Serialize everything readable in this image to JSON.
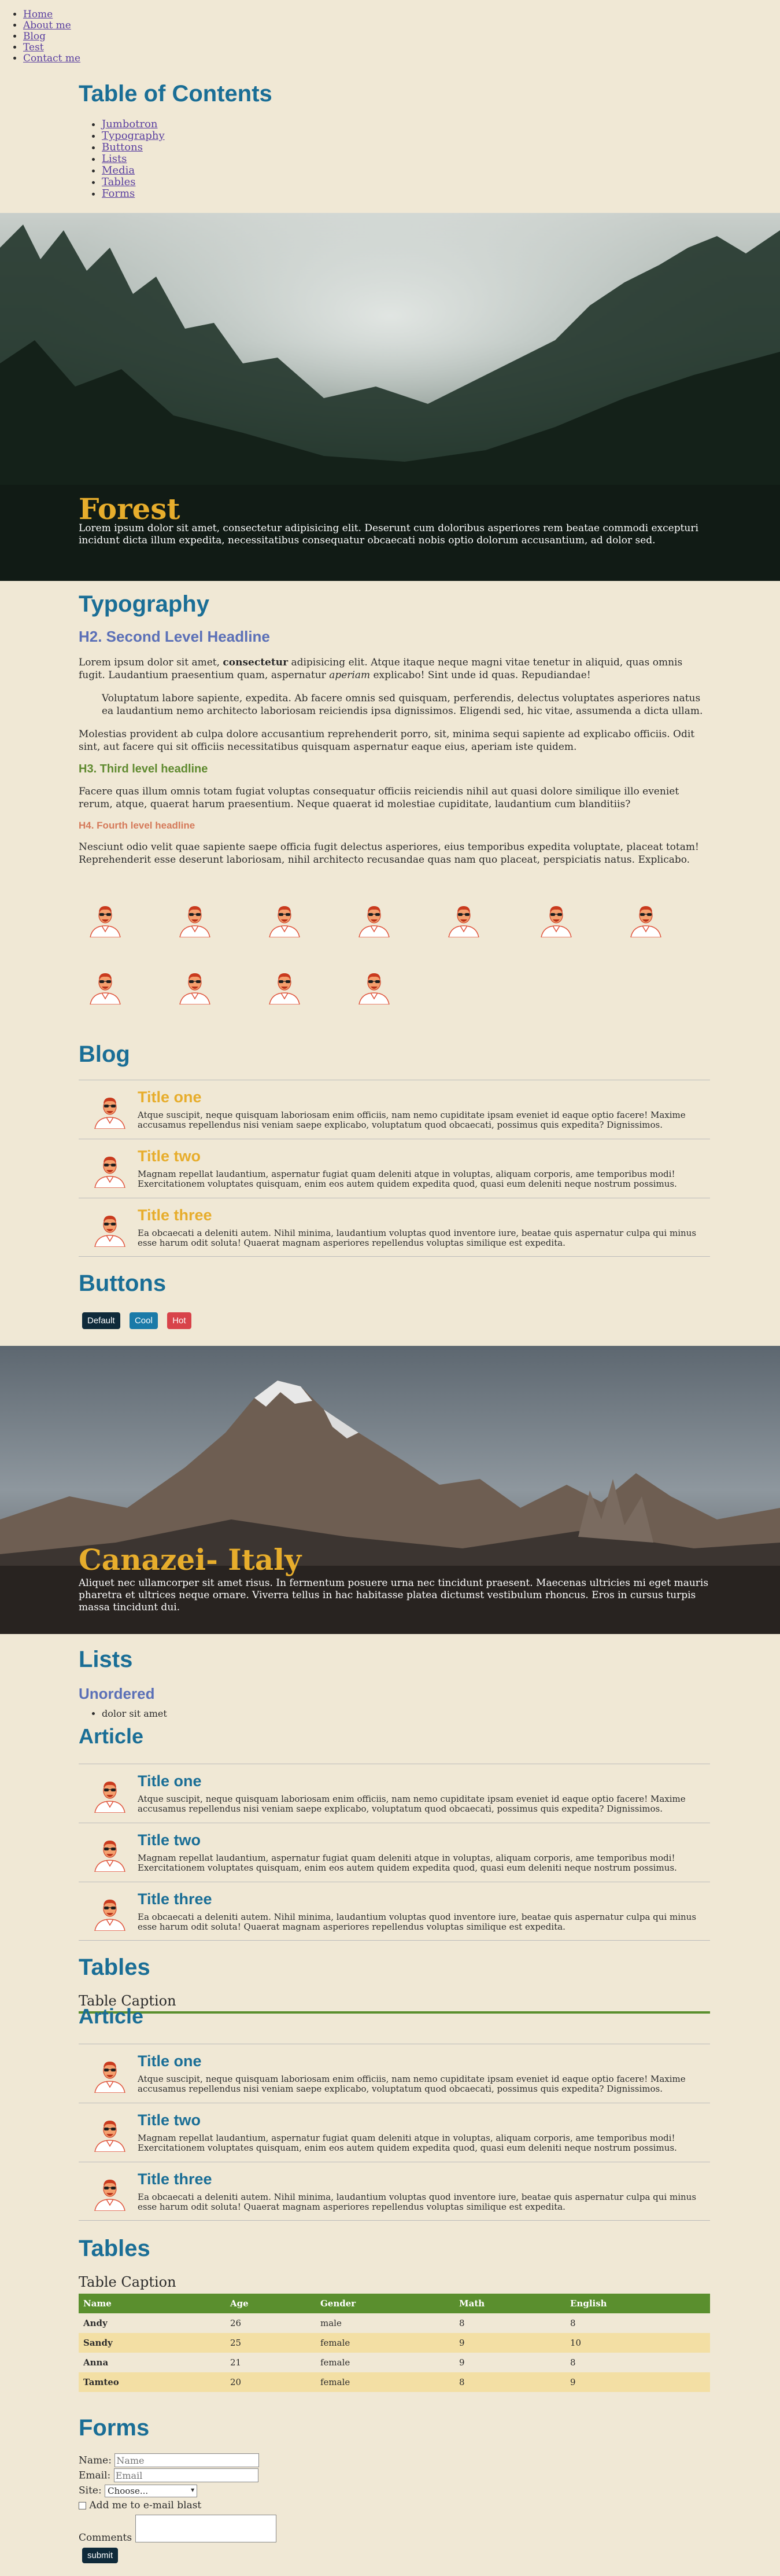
{
  "nav": [
    "Home",
    "About me",
    "Blog",
    "Test",
    "Contact me"
  ],
  "toc": {
    "title": "Table of Contents",
    "items": [
      "Jumbotron",
      "Typography",
      "Buttons",
      "Lists",
      "Media",
      "Tables",
      "Forms"
    ]
  },
  "hero1": {
    "title": "Forest",
    "text": "Lorem ipsum dolor sit amet, consectetur adipisicing elit. Deserunt cum doloribus asperiores rem beatae commodi excepturi incidunt dicta illum expedita, necessitatibus consequatur obcaecati nobis optio dolorum accusantium, ad dolor sed."
  },
  "typography": {
    "title": "Typography",
    "h2": "H2. Second Level Headline",
    "p1_a": "Lorem ipsum dolor sit amet, ",
    "p1_b": "consectetur",
    "p1_c": " adipisicing elit. Atque itaque neque magni vitae tenetur in aliquid, quas omnis fugit. Laudantium praesentium quam, aspernatur ",
    "p1_d": "aperiam",
    "p1_e": " explicabo! Sint unde id quas. Repudiandae!",
    "quote": "Voluptatum labore sapiente, expedita. Ab facere omnis sed quisquam, perferendis, delectus voluptates asperiores natus ea laudantium nemo architecto laboriosam reiciendis ipsa dignissimos. Eligendi sed, hic vitae, assumenda a dicta ullam.",
    "p2": "Molestias provident ab culpa dolore accusantium reprehenderit porro, sit, minima sequi sapiente ad explicabo officiis. Odit sint, aut facere qui sit officiis necessitatibus quisquam aspernatur eaque eius, aperiam iste quidem.",
    "h3": "H3. Third level headline",
    "p3": "Facere quas illum omnis totam fugiat voluptas consequatur officiis reiciendis nihil aut quasi dolore similique illo eveniet rerum, atque, quaerat harum praesentium. Neque quaerat id molestiae cupiditate, laudantium cum blanditiis?",
    "h4": "H4. Fourth level headline",
    "p4": "Nesciunt odio velit quae sapiente saepe officia fugit delectus asperiores, eius temporibus expedita voluptate, placeat totam! Reprehenderit esse deserunt laboriosam, nihil architecto recusandae quas nam quo placeat, perspiciatis natus. Explicabo."
  },
  "articles": [
    {
      "title": "Title one",
      "desc": "Atque suscipit, neque quisquam laboriosam enim officiis, nam nemo cupiditate ipsam eveniet id eaque optio facere! Maxime accusamus repellendus nisi veniam saepe explicabo, voluptatum quod obcaecati, possimus quis expedita? Dignissimos."
    },
    {
      "title": "Title two",
      "desc": "Magnam repellat laudantium, aspernatur fugiat quam deleniti atque in voluptas, aliquam corporis, ame temporibus modi! Exercitationem voluptates quisquam, enim eos autem quidem expedita quod, quasi eum deleniti neque nostrum possimus."
    },
    {
      "title": "Title three",
      "desc": "Ea obcaecati a deleniti autem. Nihil minima, laudantium voluptas quod inventore iure, beatae quis aspernatur culpa qui minus esse harum odit soluta! Quaerat magnam asperiores repellendus voluptas similique est expedita."
    }
  ],
  "blog": {
    "title": "Blog"
  },
  "buttons": {
    "title": "Buttons",
    "default": "Default",
    "cool": "Cool",
    "hot": "Hot"
  },
  "hero2": {
    "title": "Canazei- Italy",
    "text": "Aliquet nec ullamcorper sit amet risus. In fermentum posuere urna nec tincidunt praesent. Maecenas ultricies mi eget mauris pharetra et ultrices neque ornare. Viverra tellus in hac habitasse platea dictumst vestibulum rhoncus. Eros in cursus turpis massa tincidunt dui."
  },
  "lists": {
    "title": "Lists",
    "unordered": "Unordered",
    "item1": "dolor sit amet",
    "overlap": "Article"
  },
  "tables": {
    "title": "Tables",
    "caption": "Table Caption",
    "overlap": "Article",
    "headers": [
      "Name",
      "Age",
      "Gender",
      "Math",
      "English"
    ],
    "rows": [
      [
        "Andy",
        "26",
        "male",
        "8",
        "8"
      ],
      [
        "Sandy",
        "25",
        "female",
        "9",
        "10"
      ],
      [
        "Anna",
        "21",
        "female",
        "9",
        "8"
      ],
      [
        "Tamteo",
        "20",
        "female",
        "8",
        "9"
      ]
    ]
  },
  "forms": {
    "title": "Forms",
    "name_label": "Name:",
    "name_placeholder": "Name",
    "email_label": "Email:",
    "email_placeholder": "Email",
    "site_label": "Site:",
    "site_value": "Choose...",
    "checkbox_label": "Add me to e-mail blast",
    "comments_label": "Comments",
    "submit": "submit"
  },
  "colors": {
    "background": "#f0e8d5",
    "heading": "#1a6e96",
    "hero_title": "#e7ad2c",
    "btn_default": "#0f2a3a",
    "btn_cool": "#1a7aa8",
    "btn_hot": "#d8434a",
    "table_header": "#5a8f2e"
  }
}
